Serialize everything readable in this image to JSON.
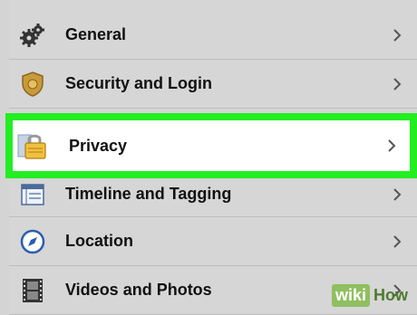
{
  "settings": {
    "items": [
      {
        "label": "General",
        "icon": "gears-icon"
      },
      {
        "label": "Security and Login",
        "icon": "badge-shield-icon"
      },
      {
        "label": "Privacy",
        "icon": "lock-icon",
        "highlighted": true
      },
      {
        "label": "Timeline and Tagging",
        "icon": "timeline-icon"
      },
      {
        "label": "Location",
        "icon": "compass-icon"
      },
      {
        "label": "Videos and Photos",
        "icon": "film-strip-icon"
      }
    ]
  },
  "watermark": {
    "wiki": "wiki",
    "how": "How"
  },
  "colors": {
    "highlight": "#22ee22",
    "row_bg": "#d6d6d6",
    "accent_blue": "#2a5db0"
  }
}
